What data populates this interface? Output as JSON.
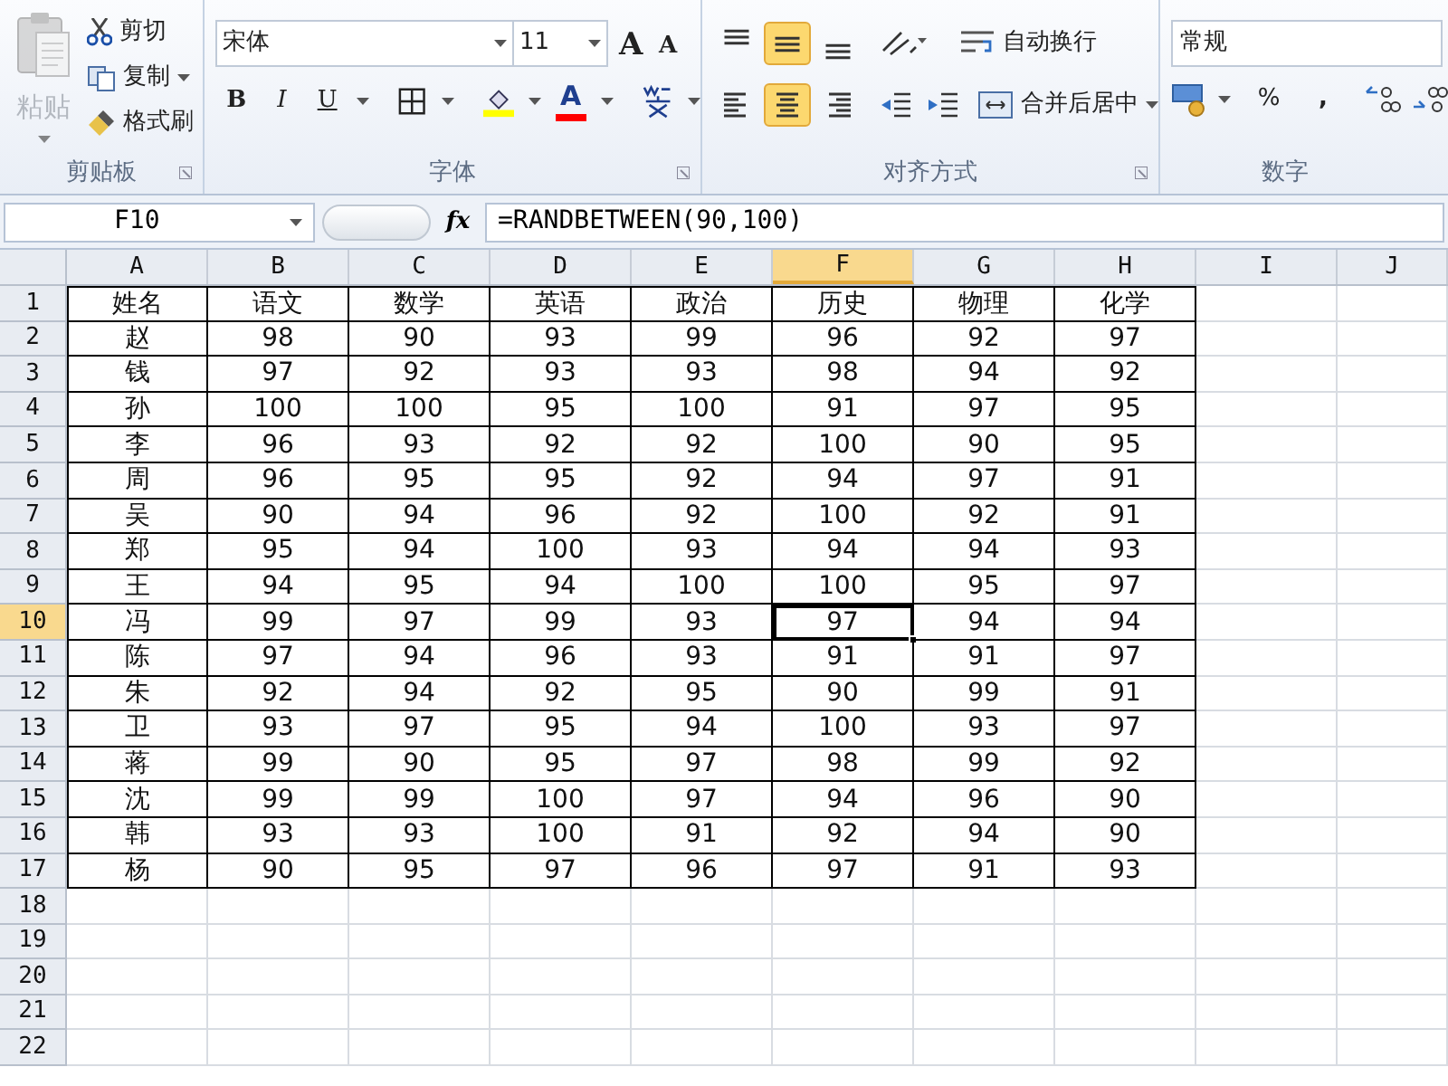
{
  "ribbon": {
    "clipboard": {
      "label": "剪贴板",
      "paste": {
        "label": "粘贴",
        "disabled": true
      },
      "cut": "剪切",
      "copy": "复制",
      "format_painter": "格式刷"
    },
    "font": {
      "label": "字体",
      "font_name": "宋体",
      "font_size": "11",
      "grow": "A",
      "shrink": "A",
      "bold": "B",
      "italic": "I",
      "underline": "U",
      "font_color": "A"
    },
    "alignment": {
      "label": "对齐方式",
      "vertical": [
        {
          "kind": "top",
          "selected": false
        },
        {
          "kind": "middle",
          "selected": true
        },
        {
          "kind": "bottom",
          "selected": false
        }
      ],
      "horizontal": [
        {
          "kind": "left",
          "selected": false
        },
        {
          "kind": "center",
          "selected": true
        },
        {
          "kind": "right",
          "selected": false
        }
      ],
      "wrap_text": "自动换行",
      "merge_center": "合并后居中"
    },
    "number": {
      "label": "数字",
      "format": "常规",
      "percent": "%",
      "comma": ","
    }
  },
  "formula_bar": {
    "name_box": "F10",
    "fx": "fx",
    "formula": "=RANDBETWEEN(90,100)"
  },
  "sheet": {
    "columns": [
      {
        "label": "A",
        "selected": false
      },
      {
        "label": "B",
        "selected": false
      },
      {
        "label": "C",
        "selected": false
      },
      {
        "label": "D",
        "selected": false
      },
      {
        "label": "E",
        "selected": false
      },
      {
        "label": "F",
        "selected": true
      },
      {
        "label": "G",
        "selected": false
      },
      {
        "label": "H",
        "selected": false
      },
      {
        "label": "I",
        "selected": false
      },
      {
        "label": "J",
        "selected": false
      }
    ],
    "rows": [
      {
        "number": "1",
        "selected": false,
        "cells": [
          "姓名",
          "语文",
          "数学",
          "英语",
          "政治",
          "历史",
          "物理",
          "化学"
        ]
      },
      {
        "number": "2",
        "selected": false,
        "cells": [
          "赵",
          "98",
          "90",
          "93",
          "99",
          "96",
          "92",
          "97"
        ]
      },
      {
        "number": "3",
        "selected": false,
        "cells": [
          "钱",
          "97",
          "92",
          "93",
          "93",
          "98",
          "94",
          "92"
        ]
      },
      {
        "number": "4",
        "selected": false,
        "cells": [
          "孙",
          "100",
          "100",
          "95",
          "100",
          "91",
          "97",
          "95"
        ]
      },
      {
        "number": "5",
        "selected": false,
        "cells": [
          "李",
          "96",
          "93",
          "92",
          "92",
          "100",
          "90",
          "95"
        ]
      },
      {
        "number": "6",
        "selected": false,
        "cells": [
          "周",
          "96",
          "95",
          "95",
          "92",
          "94",
          "97",
          "91"
        ]
      },
      {
        "number": "7",
        "selected": false,
        "cells": [
          "吴",
          "90",
          "94",
          "96",
          "92",
          "100",
          "92",
          "91"
        ]
      },
      {
        "number": "8",
        "selected": false,
        "cells": [
          "郑",
          "95",
          "94",
          "100",
          "93",
          "94",
          "94",
          "93"
        ]
      },
      {
        "number": "9",
        "selected": false,
        "cells": [
          "王",
          "94",
          "95",
          "94",
          "100",
          "100",
          "95",
          "97"
        ]
      },
      {
        "number": "10",
        "selected": true,
        "cells": [
          "冯",
          "99",
          "97",
          "99",
          "93",
          "97",
          "94",
          "94"
        ]
      },
      {
        "number": "11",
        "selected": false,
        "cells": [
          "陈",
          "97",
          "94",
          "96",
          "93",
          "91",
          "91",
          "97"
        ]
      },
      {
        "number": "12",
        "selected": false,
        "cells": [
          "朱",
          "92",
          "94",
          "92",
          "95",
          "90",
          "99",
          "91"
        ]
      },
      {
        "number": "13",
        "selected": false,
        "cells": [
          "卫",
          "93",
          "97",
          "95",
          "94",
          "100",
          "93",
          "97"
        ]
      },
      {
        "number": "14",
        "selected": false,
        "cells": [
          "蒋",
          "99",
          "90",
          "95",
          "97",
          "98",
          "99",
          "92"
        ]
      },
      {
        "number": "15",
        "selected": false,
        "cells": [
          "沈",
          "99",
          "99",
          "100",
          "97",
          "94",
          "96",
          "90"
        ]
      },
      {
        "number": "16",
        "selected": false,
        "cells": [
          "韩",
          "93",
          "93",
          "100",
          "91",
          "92",
          "94",
          "90"
        ]
      },
      {
        "number": "17",
        "selected": false,
        "cells": [
          "杨",
          "90",
          "95",
          "97",
          "96",
          "97",
          "91",
          "93"
        ]
      },
      {
        "number": "18",
        "selected": false
      },
      {
        "number": "19",
        "selected": false
      },
      {
        "number": "20",
        "selected": false
      },
      {
        "number": "21",
        "selected": false
      },
      {
        "number": "22",
        "selected": false
      }
    ]
  }
}
